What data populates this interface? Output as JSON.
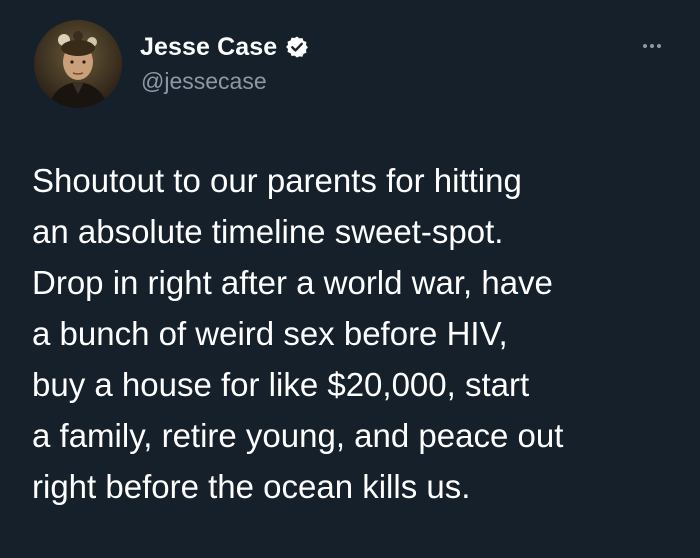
{
  "author": {
    "display_name": "Jesse Case",
    "handle": "@jessecase",
    "verified": true,
    "avatar_icon": "profile-photo"
  },
  "more_icon": "more-horizontal-icon",
  "tweet": {
    "lines": [
      "Shoutout to our parents for hitting",
      "an absolute timeline sweet-spot.",
      "Drop in right after a world war, have",
      "a bunch of weird sex before HIV,",
      "buy a house for like $20,000, start",
      "a family, retire young, and peace out",
      "right before the ocean kills us."
    ]
  },
  "colors": {
    "background": "#15202b",
    "text_primary": "#ffffff",
    "text_secondary": "#8b98a5"
  }
}
